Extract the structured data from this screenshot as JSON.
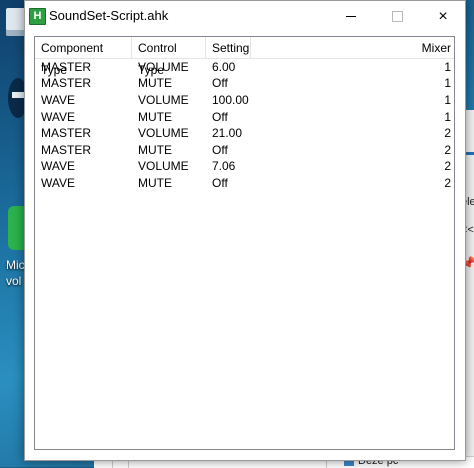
{
  "window": {
    "title": "SoundSet-Script.ahk",
    "app_icon_letter": "H",
    "buttons": {
      "minimize": "minimize",
      "maximize": "maximize",
      "close": "×"
    }
  },
  "listview": {
    "columns": [
      "Component Type",
      "Control Type",
      "Setting",
      "Mixer"
    ],
    "rows": [
      [
        "MASTER",
        "VOLUME",
        "6.00",
        "1"
      ],
      [
        "MASTER",
        "MUTE",
        "Off",
        "1"
      ],
      [
        "WAVE",
        "VOLUME",
        "100.00",
        "1"
      ],
      [
        "WAVE",
        "MUTE",
        "Off",
        "1"
      ],
      [
        "MASTER",
        "VOLUME",
        "21.00",
        "2"
      ],
      [
        "MASTER",
        "MUTE",
        "Off",
        "2"
      ],
      [
        "WAVE",
        "VOLUME",
        "7.06",
        "2"
      ],
      [
        "WAVE",
        "MUTE",
        "Off",
        "2"
      ]
    ]
  },
  "desktop": {
    "icon_label_line1": "Mic",
    "icon_label_line2": "vol"
  },
  "background_window": {
    "chevron": "<",
    "text1": "ele",
    "text2": "<<",
    "pin": "📌"
  },
  "taskbar_hint": {
    "label": "Deze pc"
  },
  "colors": {
    "app_icon_green": "#2f9e44",
    "desktop_blue": "#1b6e9e"
  }
}
